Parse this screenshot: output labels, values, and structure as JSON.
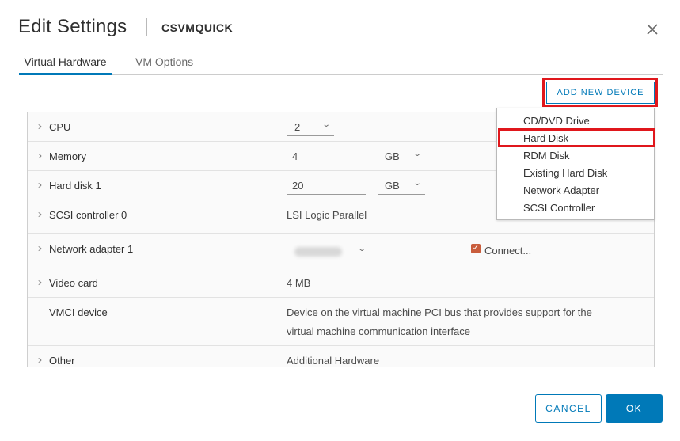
{
  "dialog": {
    "title": "Edit Settings",
    "vm_name": "CSVMQUICK",
    "close_icon": "close-icon"
  },
  "tabs": [
    {
      "label": "Virtual Hardware",
      "active": true
    },
    {
      "label": "VM Options",
      "active": false
    }
  ],
  "toolbar": {
    "add_device_label": "ADD NEW DEVICE"
  },
  "hardware": {
    "cpu": {
      "label": "CPU",
      "value": "2"
    },
    "memory": {
      "label": "Memory",
      "value": "4",
      "unit": "GB"
    },
    "hard_disk": {
      "label": "Hard disk 1",
      "value": "20",
      "unit": "GB"
    },
    "scsi": {
      "label": "SCSI controller 0",
      "value": "LSI Logic Parallel"
    },
    "network": {
      "label": "Network adapter 1",
      "connect_label": "Connect...",
      "connected": true
    },
    "video": {
      "label": "Video card",
      "value": "4 MB"
    },
    "vmci": {
      "label": "VMCI device",
      "line1": "Device on the virtual machine PCI bus that provides support for the",
      "line2": "virtual machine communication interface"
    },
    "other": {
      "label": "Other",
      "value": "Additional Hardware"
    }
  },
  "device_menu": {
    "items": [
      "CD/DVD Drive",
      "Hard Disk",
      "RDM Disk",
      "Existing Hard Disk",
      "Network Adapter",
      "SCSI Controller"
    ],
    "highlighted": "Hard Disk"
  },
  "footer": {
    "cancel_label": "CANCEL",
    "ok_label": "OK"
  },
  "colors": {
    "accent": "#0079b8",
    "highlight_box": "#e0171c",
    "checkbox": "#c95d3c"
  }
}
